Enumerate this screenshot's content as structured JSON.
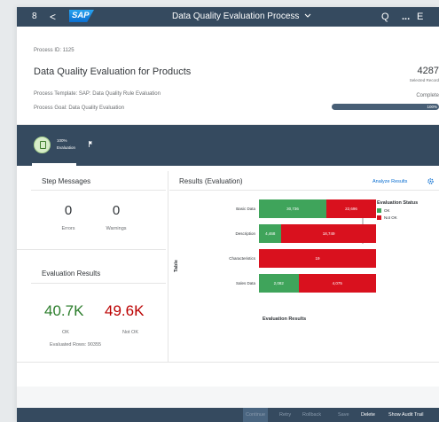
{
  "shell": {
    "title": "Data Quality Evaluation Process",
    "logo_text": "SAP",
    "back_glyph": "<",
    "user_glyph": "8",
    "search_glyph": "Q",
    "more_glyph": "...",
    "last_glyph": "E"
  },
  "header": {
    "process_id": "Process ID: 1125",
    "title": "Data Quality Evaluation for Products",
    "process_template": "Process Template: SAP: Data Quality Rule Evaluation",
    "process_goal": "Process Goal: Data Quality Evaluation",
    "kpi_value": "4287",
    "kpi_label": "Selected Record",
    "status": "Complete",
    "progress_label": "100%",
    "progress": 1.0
  },
  "anchor": {
    "percent": "100%",
    "label": "Evaluation"
  },
  "step_messages": {
    "title": "Step Messages",
    "errors_value": "0",
    "errors_label": "Errors",
    "warnings_value": "0",
    "warnings_label": "Warnings"
  },
  "evaluation_results": {
    "title": "Evaluation Results",
    "ok_value": "40.7K",
    "ok_label": "OK",
    "notok_value": "49.6K",
    "notok_label": "Not OK",
    "evaluated_rows": "Evaluated Rows:  90355"
  },
  "results_card": {
    "title": "Results (Evaluation)",
    "analyze_link": "Analyze Results"
  },
  "chart_data": {
    "type": "bar",
    "orientation": "horizontal",
    "stacked": true,
    "ylabel": "Table",
    "xlabel": "Evaluation Results",
    "legend_title": "Evaluation Status",
    "legend_position": "right",
    "categories": [
      "Basic Data",
      "Description",
      "Characteristics",
      "Sales Data"
    ],
    "series": [
      {
        "name": "OK",
        "color": "#3fa45b",
        "values": [
          30736,
          4468,
          0,
          2082
        ],
        "labels": [
          "30,736",
          "4,468",
          "",
          "2,082"
        ]
      },
      {
        "name": "Not OK",
        "color": "#d9111e",
        "values": [
          22696,
          18749,
          19,
          4075
        ],
        "labels": [
          "22,696",
          "18,749",
          "19",
          "4,075"
        ]
      }
    ]
  },
  "footer": {
    "buttons": [
      "Continue",
      "Retry",
      "Rollback",
      "Save",
      "Delete",
      "Show Audit Trail"
    ]
  },
  "colors": {
    "shell": "#354a5f",
    "ok": "#2b7d2b",
    "not_ok": "#bb0000",
    "link": "#0a6ed1"
  }
}
